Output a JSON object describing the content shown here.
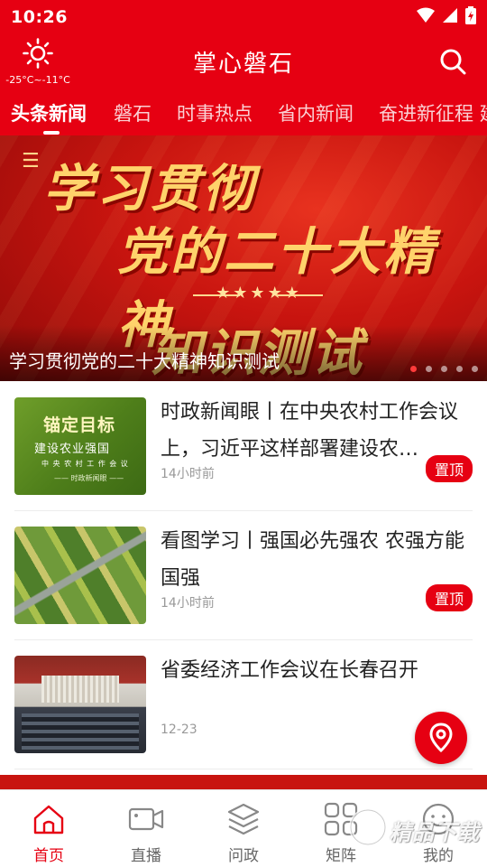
{
  "status_bar": {
    "time": "10:26"
  },
  "header": {
    "weather": {
      "icon": "sun-icon",
      "temp": "-25°C~-11°C"
    },
    "title": "掌心磐石",
    "search_icon": "search-icon"
  },
  "tabs": [
    {
      "label": "头条新闻",
      "active": true
    },
    {
      "label": "磐石"
    },
    {
      "label": "时事热点"
    },
    {
      "label": "省内新闻"
    },
    {
      "label": "奋进新征程 建"
    }
  ],
  "banner": {
    "line1": "学习贯彻",
    "line2": "党的二十大精神",
    "stars": "★★★★★",
    "line3": "知识测试",
    "caption": "学习贯彻党的二十大精神知识测试",
    "slide_count": 5,
    "active_slide": 1
  },
  "news": [
    {
      "headline": "时政新闻眼丨在中央农村工作会议上，习近平这样部署建设农…",
      "time": "14小时前",
      "pinned_label": "置顶",
      "thumb_text": {
        "line1": "锚定目标",
        "line2": "建设农业强国",
        "line3": "中 央 农 村 工 作 会 议",
        "line4": "—— 时政新闻眼 ——"
      }
    },
    {
      "headline": "看图学习丨强国必先强农 农强方能国强",
      "time": "14小时前",
      "pinned_label": "置顶"
    },
    {
      "headline": "省委经济工作会议在长春召开",
      "time": "12-23"
    }
  ],
  "bottom_nav": [
    {
      "label": "首页",
      "icon": "home-icon",
      "active": true
    },
    {
      "label": "直播",
      "icon": "video-camera-icon"
    },
    {
      "label": "问政",
      "icon": "layers-icon"
    },
    {
      "label": "矩阵",
      "icon": "grid-icon"
    },
    {
      "label": "我的",
      "icon": "smiley-user-icon"
    }
  ],
  "watermark": {
    "text": "精品下载"
  },
  "colors": {
    "brand_red": "#e60012",
    "banner_gold": "#ffd36b"
  }
}
